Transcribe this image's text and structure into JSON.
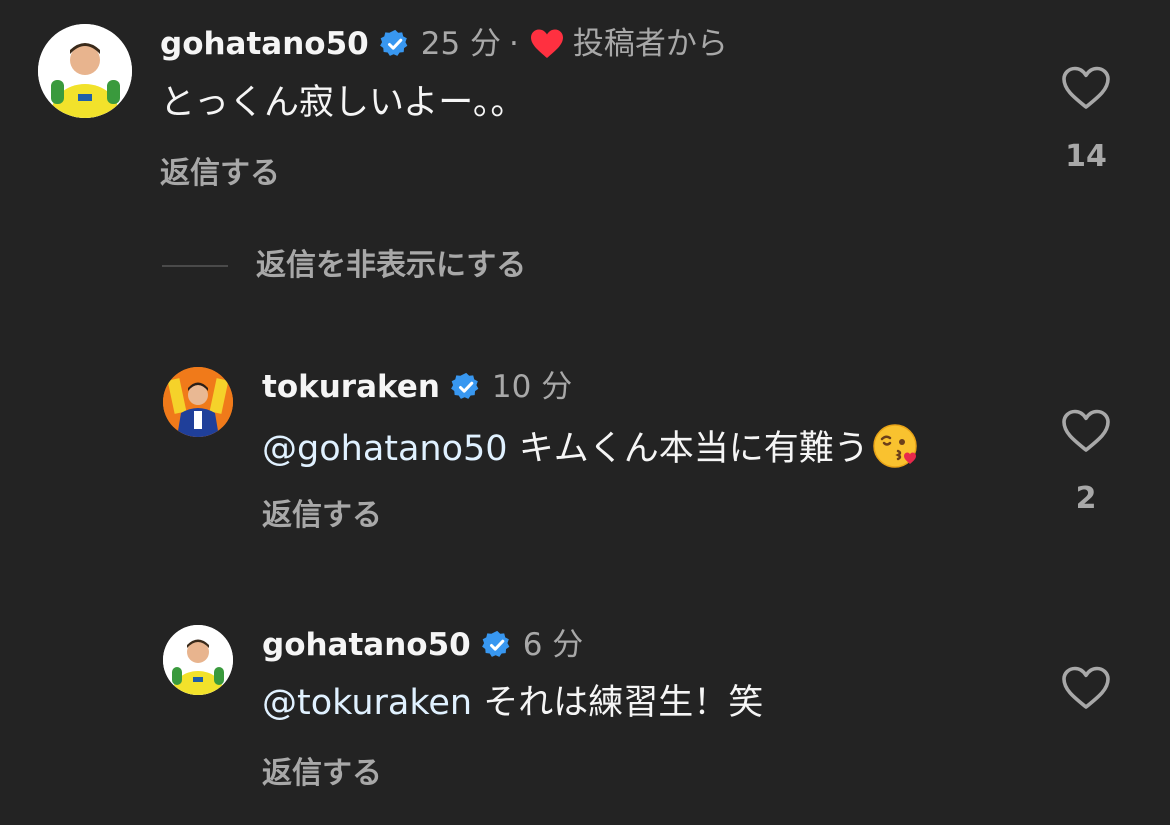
{
  "colors": {
    "background": "#232323",
    "primary_text": "#f5f5f5",
    "secondary_text": "#a8a8a8",
    "verified_blue": "#3897f0",
    "heart_red": "#ff3040",
    "mention": "#e0f1ff"
  },
  "comments": [
    {
      "username": "gohatano50",
      "verified": true,
      "time": "25 分",
      "separator": "·",
      "liked_by_author_icon": "heart-filled-icon",
      "liked_by_author_label": "投稿者から",
      "text": "とっくん寂しいよー。。",
      "reply_label": "返信する",
      "like_icon": "heart-outline-icon",
      "like_count": "14"
    },
    {
      "username": "tokuraken",
      "verified": true,
      "time": "10 分",
      "mention": "@gohatano50",
      "text": " キムくん本当に有難う",
      "emoji": "face-blowing-kiss-emoji",
      "reply_label": "返信する",
      "like_icon": "heart-outline-icon",
      "like_count": "2"
    },
    {
      "username": "gohatano50",
      "verified": true,
      "time": "6 分",
      "mention": "@tokuraken",
      "text": " それは練習生！笑",
      "reply_label": "返信する",
      "like_icon": "heart-outline-icon",
      "like_count": ""
    }
  ],
  "hide_replies_label": "返信を非表示にする"
}
